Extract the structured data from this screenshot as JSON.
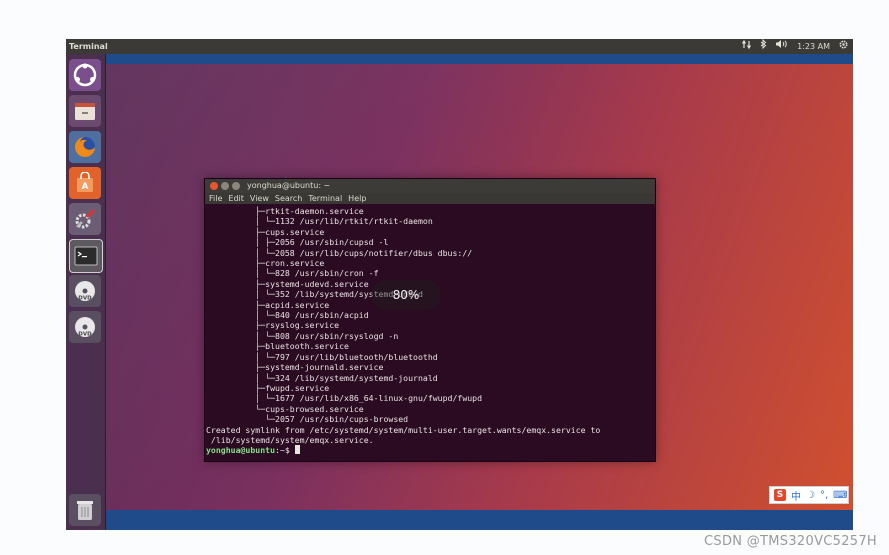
{
  "topbar": {
    "app_title": "Terminal",
    "time": "1:23 AM",
    "tray_icons": [
      "network-icon",
      "bluetooth-icon",
      "volume-icon",
      "settings-gear-icon"
    ]
  },
  "launcher": {
    "items": [
      "ubuntu-dash-icon",
      "files-icon",
      "firefox-icon",
      "software-store-icon",
      "system-settings-icon",
      "terminal-icon",
      "dvd-icon",
      "dvd-icon",
      "trash-icon"
    ]
  },
  "terminal": {
    "window_title": "yonghua@ubuntu: ~",
    "menu": [
      "File",
      "Edit",
      "View",
      "Search",
      "Terminal",
      "Help"
    ],
    "lines": [
      "          ├─rtkit-daemon.service",
      "          │ └─1132 /usr/lib/rtkit/rtkit-daemon",
      "          ├─cups.service",
      "          │ ├─2056 /usr/sbin/cupsd -l",
      "          │ └─2058 /usr/lib/cups/notifier/dbus dbus://",
      "          ├─cron.service",
      "          │ └─828 /usr/sbin/cron -f",
      "          ├─systemd-udevd.service",
      "          │ └─352 /lib/systemd/systemd-udevd",
      "          ├─acpid.service",
      "          │ └─840 /usr/sbin/acpid",
      "          ├─rsyslog.service",
      "          │ └─808 /usr/sbin/rsyslogd -n",
      "          ├─bluetooth.service",
      "          │ └─797 /usr/lib/bluetooth/bluetoothd",
      "          ├─systemd-journald.service",
      "          │ └─324 /lib/systemd/systemd-journald",
      "          ├─fwupd.service",
      "          │ └─1677 /usr/lib/x86_64-linux-gnu/fwupd/fwupd",
      "          └─cups-browsed.service",
      "            └─2057 /usr/sbin/cups-browsed",
      "Created symlink from /etc/systemd/system/multi-user.target.wants/emqx.service to",
      " /lib/systemd/system/emqx.service."
    ],
    "prompt_user": "yonghua@ubuntu",
    "prompt_suffix": ":~$ "
  },
  "volume_osd": {
    "text": "80%"
  },
  "ime_bar": {
    "mode": "中"
  },
  "watermark": "CSDN @TMS320VC5257H"
}
